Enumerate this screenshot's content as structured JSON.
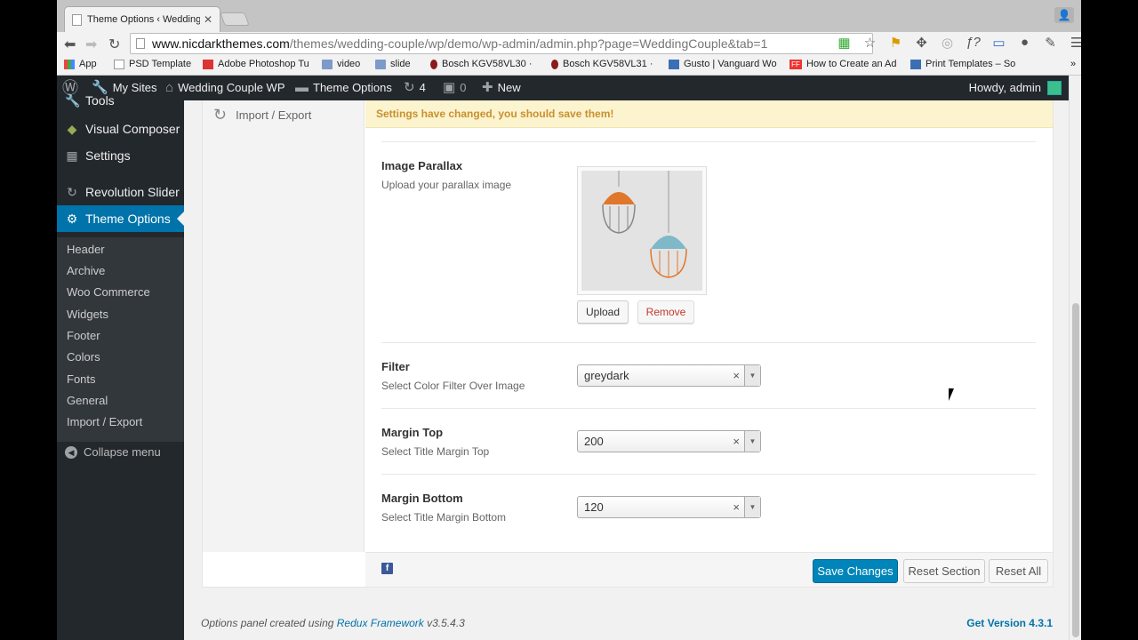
{
  "browser": {
    "tab_title": "Theme Options ‹ Wedding",
    "url_host": "www.nicdarkthemes.com",
    "url_path": "/themes/wedding-couple/wp/demo/wp-admin/admin.php?page=WeddingCouple&tab=1",
    "bookmarks": [
      {
        "label": "App",
        "icon": "apps-icon"
      },
      {
        "label": "PSD Template",
        "icon": "doc-icon"
      },
      {
        "label": "Adobe Photoshop Tu",
        "icon": "plus-icon"
      },
      {
        "label": "video",
        "icon": "folder-icon"
      },
      {
        "label": "slide",
        "icon": "folder-icon"
      },
      {
        "label": "Bosch KGV58VL30 ·",
        "icon": "bosch-icon"
      },
      {
        "label": "Bosch KGV58VL31 ·",
        "icon": "bosch-icon"
      },
      {
        "label": "Gusto | Vanguard Wo",
        "icon": "monitor-icon"
      },
      {
        "label": "How to Create an Ad",
        "icon": "ff-icon"
      },
      {
        "label": "Print Templates – So",
        "icon": "print-icon"
      }
    ],
    "more": "»"
  },
  "adminbar": {
    "my_sites": "My Sites",
    "site_name": "Wedding Couple WP",
    "theme_options": "Theme Options",
    "updates": "4",
    "comments": "0",
    "new": "New",
    "howdy": "Howdy, admin"
  },
  "sidebar": {
    "items": [
      {
        "label": "Tools"
      },
      {
        "label": "Visual Composer"
      },
      {
        "label": "Settings"
      },
      {
        "label": "Revolution Slider"
      },
      {
        "label": "Theme Options"
      }
    ],
    "submenu": [
      "Header",
      "Archive",
      "Woo Commerce",
      "Widgets",
      "Footer",
      "Colors",
      "Fonts",
      "General",
      "Import / Export"
    ],
    "collapse": "Collapse menu"
  },
  "panel": {
    "side_import": "Import / Export",
    "notice": "Settings have changed, you should save them!",
    "fields": {
      "parallax": {
        "title": "Image Parallax",
        "desc": "Upload your parallax image",
        "upload": "Upload",
        "remove": "Remove"
      },
      "filter": {
        "title": "Filter",
        "desc": "Select Color Filter Over Image",
        "value": "greydark"
      },
      "margin_top": {
        "title": "Margin Top",
        "desc": "Select Title Margin Top",
        "value": "200"
      },
      "margin_bottom": {
        "title": "Margin Bottom",
        "desc": "Select Title Margin Bottom",
        "value": "120"
      }
    },
    "save": "Save Changes",
    "reset_section": "Reset Section",
    "reset_all": "Reset All"
  },
  "footer": {
    "credit_prefix": "Options panel created using ",
    "credit_link": "Redux Framework",
    "credit_suffix": " v3.5.4.3",
    "version": "Get Version 4.3.1"
  },
  "colors": {
    "wp_dark": "#23282d",
    "wp_blue": "#0073aa",
    "notice_bg": "#fcf3cf",
    "notice_text": "#c8912e",
    "remove_red": "#c0392b"
  }
}
